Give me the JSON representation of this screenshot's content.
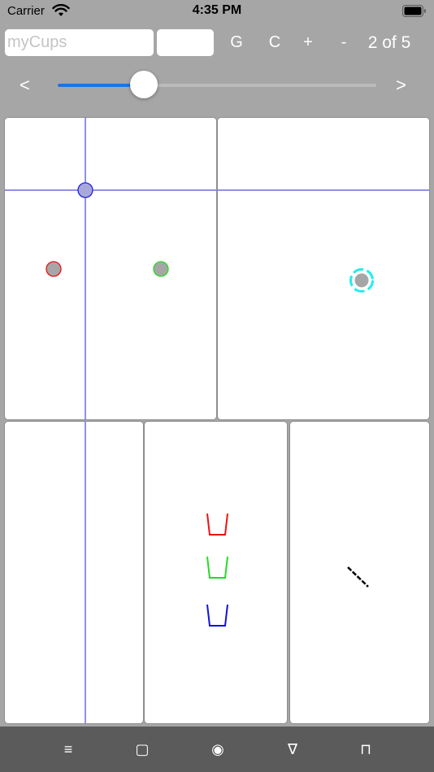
{
  "status_bar": {
    "carrier": "Carrier",
    "time": "4:35 PM"
  },
  "toolbar": {
    "name_placeholder": "myCups",
    "name_value": "",
    "secondary_value": "",
    "g_label": "G",
    "c_label": "C",
    "plus_label": "+",
    "minus_label": "-",
    "page_indicator": "2 of 5"
  },
  "slider": {
    "prev_label": "<",
    "next_label": ">",
    "value": 0.27,
    "fill_color": "#1a74e8"
  },
  "colors": {
    "guide": "#2222dd",
    "red": "#ee1111",
    "green": "#22dd22",
    "blue": "#1111dd",
    "cyan": "#22eeee",
    "marker_fill": "#a6a6a6"
  },
  "bottom_bar": {
    "items": [
      {
        "icon": "menu-icon",
        "glyph": "≡"
      },
      {
        "icon": "square-icon",
        "glyph": "▢"
      },
      {
        "icon": "target-icon",
        "glyph": "◉"
      },
      {
        "icon": "triangle-down-icon",
        "glyph": "∇"
      },
      {
        "icon": "pi-icon",
        "glyph": "⊓"
      }
    ]
  }
}
